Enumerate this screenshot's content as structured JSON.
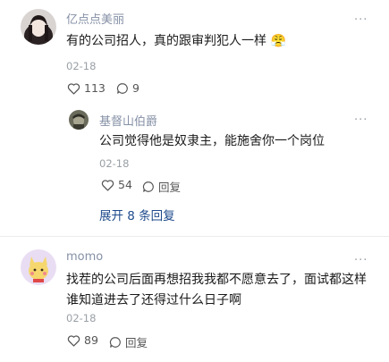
{
  "comments": [
    {
      "user": "亿点点美丽",
      "text": "有的公司招人，真的跟审判犯人一样",
      "emoji": "😤",
      "date": "02-18",
      "likes": "113",
      "replies": "9",
      "more": "···",
      "reply": {
        "user": "基督山伯爵",
        "text": "公司觉得他是奴隶主，能施舍你一个岗位",
        "date": "02-18",
        "likes": "54",
        "reply_label": "回复",
        "more": "···"
      },
      "expand_label": "展开 8 条回复"
    },
    {
      "user": "momo",
      "text_lines": [
        "找茬的公司后面再想招我我都不愿意去了，面试都这样",
        "谁知道进去了还得过什么日子啊"
      ],
      "date": "02-18",
      "likes": "89",
      "reply_label": "回复",
      "more": "···"
    }
  ]
}
